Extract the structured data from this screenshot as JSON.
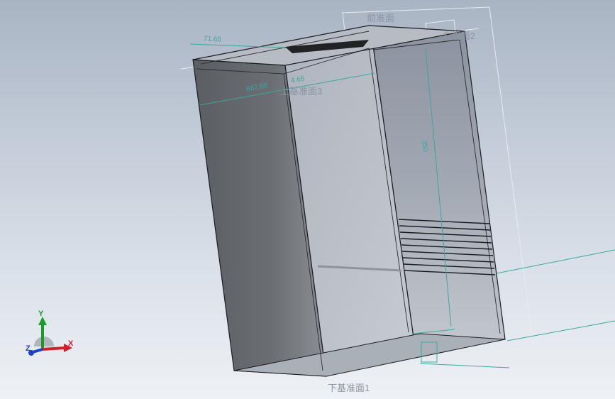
{
  "planes": {
    "front": "前准面",
    "right": "右视面2",
    "top": "上基准面3",
    "bottom": "下基准面1"
  },
  "dimensions": {
    "width_top": "71.65",
    "depth": "887.85",
    "depth_small": "4.65",
    "height_ticks": "350"
  },
  "triad": {
    "x_label": "X",
    "y_label": "Y",
    "z_label": "Z"
  },
  "colors": {
    "dimension": "#3aa7a0",
    "x_axis": "#d2202a",
    "y_axis": "#1a9a2a",
    "z_axis": "#1f3fd0"
  }
}
